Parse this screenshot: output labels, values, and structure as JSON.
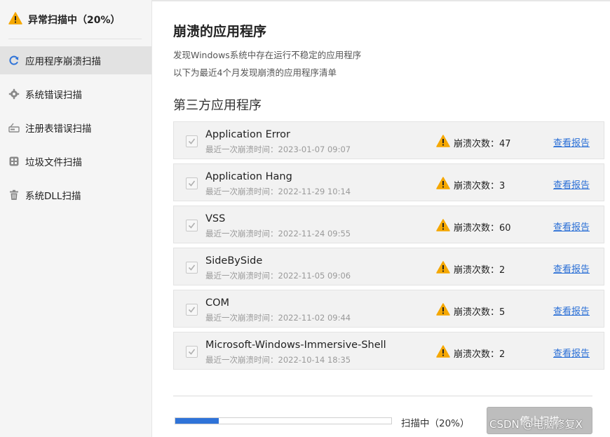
{
  "sidebar": {
    "scan_status": "异常扫描中（20%）",
    "items": [
      {
        "label": "应用程序崩溃扫描",
        "icon": "refresh-icon",
        "active": true
      },
      {
        "label": "系统错误扫描",
        "icon": "gear-icon",
        "active": false
      },
      {
        "label": "注册表错误扫描",
        "icon": "registry-icon",
        "active": false
      },
      {
        "label": "垃圾文件扫描",
        "icon": "junk-box-icon",
        "active": false
      },
      {
        "label": "系统DLL扫描",
        "icon": "trash-icon",
        "active": false
      }
    ]
  },
  "main": {
    "title": "崩溃的应用程序",
    "desc1": "发现Windows系统中存在运行不稳定的应用程序",
    "desc2": "以下为最近4个月发现崩溃的应用程序清单",
    "section_title": "第三方应用程序",
    "report_label": "查看报告",
    "apps": [
      {
        "name": "Application Error",
        "time": "最近一次崩溃时间：2023-01-07 09:07",
        "count": "崩溃次数：47"
      },
      {
        "name": "Application Hang",
        "time": "最近一次崩溃时间：2022-11-29 10:14",
        "count": "崩溃次数：3"
      },
      {
        "name": "VSS",
        "time": "最近一次崩溃时间：2022-11-24 09:55",
        "count": "崩溃次数：60"
      },
      {
        "name": "SideBySide",
        "time": "最近一次崩溃时间：2022-11-05 09:06",
        "count": "崩溃次数：2"
      },
      {
        "name": "COM",
        "time": "最近一次崩溃时间：2022-11-02 09:44",
        "count": "崩溃次数：5"
      },
      {
        "name": "Microsoft-Windows-Immersive-Shell",
        "time": "最近一次崩溃时间：2022-10-14 18:35",
        "count": "崩溃次数：2"
      }
    ]
  },
  "footer": {
    "progress_percent": 20,
    "progress_label": "扫描中（20%）",
    "stop_label": "停止扫描",
    "watermark": "CSDN @电脑修复X"
  },
  "colors": {
    "accent": "#2f73d8",
    "warning": "#f5a700",
    "link": "#2a6fd6"
  }
}
